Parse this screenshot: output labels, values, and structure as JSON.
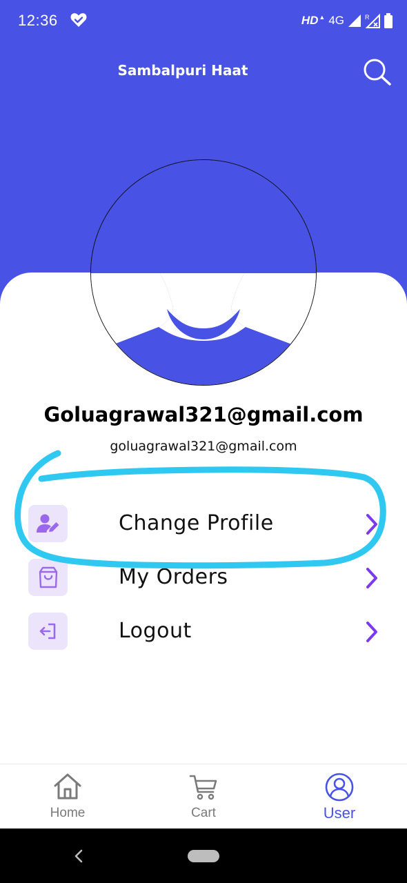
{
  "status_bar": {
    "time": "12:36",
    "hd_label": "HD",
    "network_label": "4G",
    "roaming_label": "R",
    "icons": [
      "heart-check-icon",
      "data-activity-icon",
      "signal-icon",
      "roaming-signal-icon",
      "battery-icon"
    ]
  },
  "header": {
    "title": "Sambalpuri Haat",
    "search_icon": "search-icon",
    "background_color": "#4852e4"
  },
  "profile": {
    "name": "Goluagrawal321@gmail.com",
    "email": "goluagrawal321@gmail.com",
    "avatar_icon": "user-avatar-icon"
  },
  "menu": {
    "items": [
      {
        "label": "Change Profile",
        "icon": "edit-user-icon"
      },
      {
        "label": "My Orders",
        "icon": "shopping-bag-icon"
      },
      {
        "label": "Logout",
        "icon": "logout-icon"
      }
    ],
    "accent_color": "#7c3aed",
    "icon_background": "#ece4fb"
  },
  "bottom_nav": {
    "items": [
      {
        "label": "Home",
        "icon": "home-icon",
        "active": false
      },
      {
        "label": "Cart",
        "icon": "cart-icon",
        "active": false
      },
      {
        "label": "User",
        "icon": "user-icon",
        "active": true
      }
    ],
    "active_color": "#4852e4"
  },
  "annotation": {
    "type": "hand-drawn highlight around Change Profile",
    "color": "#2ec8f0"
  },
  "system_nav": {
    "icons": [
      "back-icon",
      "home-pill-icon"
    ]
  }
}
